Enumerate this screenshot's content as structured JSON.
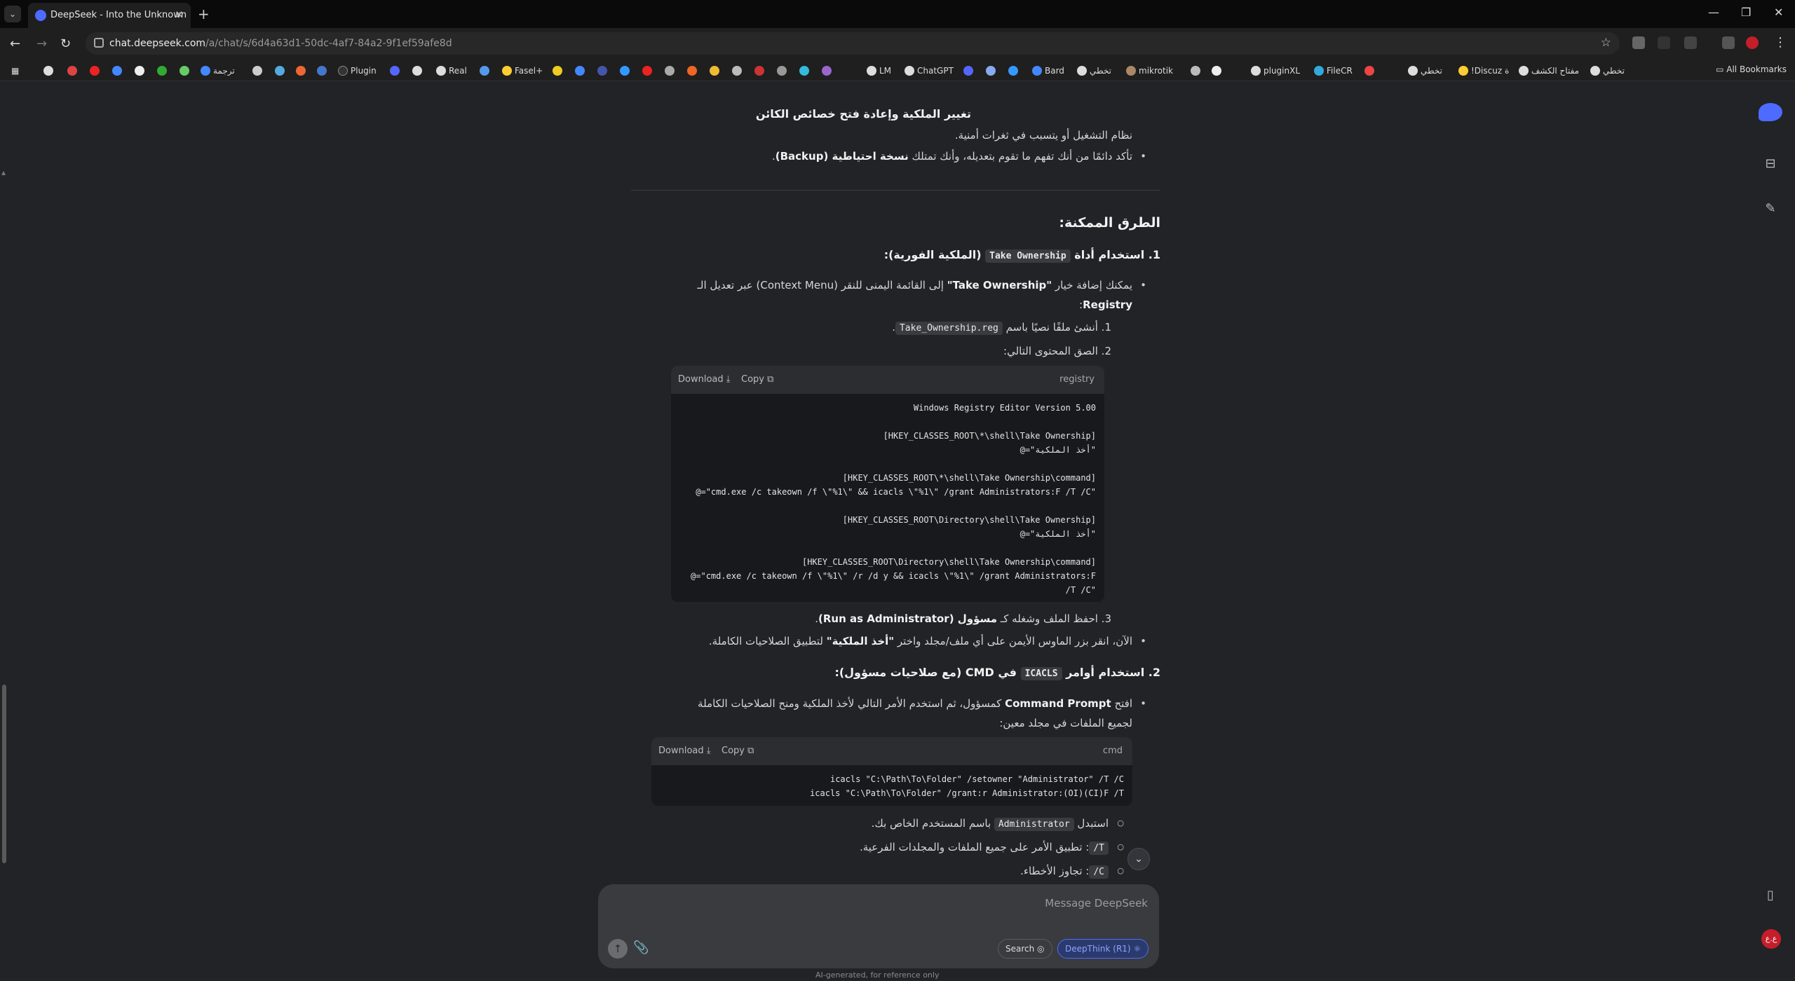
{
  "browser": {
    "tab_title": "DeepSeek - Into the Unknown",
    "url_host": "chat.deepseek.com",
    "url_path": "/a/chat/s/6d4a63d1-50dc-4af7-84a2-9f1ef59afe8d",
    "all_bookmarks": "All Bookmarks",
    "bookmarks": [
      "ترجمة",
      "Plugin",
      "Real",
      "Fasel+",
      "LM",
      "ChatGPT",
      "Bard",
      "تخطي",
      "mikrotik",
      "pluginXL",
      "FileCR",
      "تخطي",
      "!Discuz ة",
      "مفتاح الكشف",
      "تخطي"
    ]
  },
  "content": {
    "top_heading": "تغيير الملكية وإعادة فتح خصائص الكائن",
    "top_line": "نظام التشغيل أو يتسبب في ثغرات أمنية.",
    "backup_prefix": "تأكد دائمًا من أنك تفهم ما تقوم بتعديله، وأنك تمتلك ",
    "backup_bold": "نسخة احتياطية (Backup)",
    "methods_heading": "الطرق الممكنة:",
    "m1_prefix": "1. استخدام أداة ",
    "m1_code": "Take Ownership",
    "m1_suffix": " (الملكية الفورية):",
    "m1_bullet_a": "يمكنك إضافة خيار ",
    "m1_bullet_bold": "\"Take Ownership\"",
    "m1_bullet_b": " إلى القائمة اليمنى للنقر (Context Menu) عبر تعديل الـ",
    "m1_bullet_line2": "Registry",
    "step1_a": "1. أنشئ ملفًا نصيًا باسم ",
    "step1_code": "Take_Ownership.reg",
    "step2": "2. الصق المحتوى التالي:",
    "code1_download": "Download",
    "code1_copy": "Copy",
    "code1_lang": "registry",
    "code1_lines": [
      "Windows Registry Editor Version 5.00",
      "",
      "[HKEY_CLASSES_ROOT\\*\\shell\\Take Ownership]",
      "@=\"أخذ الملكية\"",
      "",
      "[HKEY_CLASSES_ROOT\\*\\shell\\Take Ownership\\command]",
      "@=\"cmd.exe /c takeown /f \\\"%1\\\" && icacls \\\"%1\\\" /grant Administrators:F /T /C\"",
      "",
      "[HKEY_CLASSES_ROOT\\Directory\\shell\\Take Ownership]",
      "@=\"أخذ الملكية\"",
      "",
      "[HKEY_CLASSES_ROOT\\Directory\\shell\\Take Ownership\\command]",
      "@=\"cmd.exe /c takeown /f \\\"%1\\\" /r /d y && icacls \\\"%1\\\" /grant Administrators:F",
      "/T /C\""
    ],
    "step3_a": "3. احفظ الملف وشغله كـ ",
    "step3_bold": "مسؤول (Run as Administrator)",
    "now_a": "الآن، انقر بزر الماوس الأيمن على أي ملف/مجلد واختر ",
    "now_bold": "\"أخذ الملكية\"",
    "now_b": " لتطبيق الصلاحيات الكاملة.",
    "m2_prefix": "2. استخدام أوامر ",
    "m2_code": "ICACLS",
    "m2_suffix": " في CMD (مع صلاحيات مسؤول):",
    "m2_bullet_a": "افتح ",
    "m2_bullet_bold": "Command Prompt",
    "m2_bullet_b": " كمسؤول، ثم استخدم الأمر التالي لأخذ الملكية ومنح الصلاحيات الكاملة",
    "m2_bullet_line2": "لجميع الملفات في مجلد معين:",
    "code2_download": "Download",
    "code2_copy": "Copy",
    "code2_lang": "cmd",
    "code2_lines": [
      "icacls \"C:\\Path\\To\\Folder\" /setowner \"Administrator\" /T /C",
      "icacls \"C:\\Path\\To\\Folder\" /grant:r Administrator:(OI)(CI)F /T"
    ],
    "sub1_a": "استبدل ",
    "sub1_code": "Administrator",
    "sub1_b": " باسم المستخدم الخاص بك.",
    "sub2_code": "/T",
    "sub2_b": ": تطبيق الأمر على جميع الملفات والمجلدات الفرعية.",
    "sub3_code": "/C",
    "sub3_b": ": تجاوز الأخطاء."
  },
  "composer": {
    "placeholder": "Message DeepSeek",
    "search_label": "Search",
    "deepthink_label": "DeepThink (R1)",
    "disclaimer": "AI-generated, for reference only"
  },
  "user": {
    "avatar_text": "ع.ع"
  },
  "colors": {
    "accent": "#4d6bfe",
    "background": "#212327",
    "code_bg": "#18191c"
  }
}
